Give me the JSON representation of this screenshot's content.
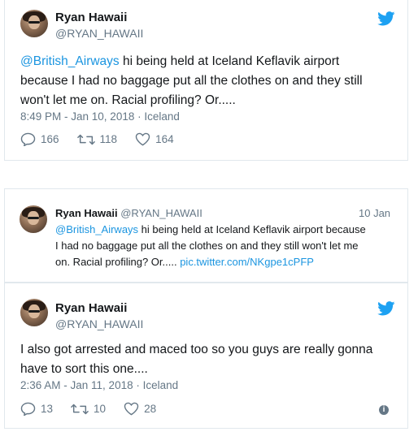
{
  "tweet1": {
    "name": "Ryan Hawaii",
    "handle": "@RYAN_HAWAII",
    "mention": "@British_Airways",
    "line1_rest": " hi being held at Iceland Keflavik airport",
    "line2": "because I had no baggage put all the clothes on and they still",
    "line3": "won't let me on. Racial profiling? Or.....",
    "timestamp": "8:49 PM - Jan 10, 2018",
    "location": "Iceland",
    "replies": "166",
    "retweets": "118",
    "likes": "164"
  },
  "quoted": {
    "name": "Ryan Hawaii",
    "handle": "@RYAN_HAWAII",
    "date": "10 Jan",
    "mention": "@British_Airways",
    "line1_rest": " hi being held at Iceland Keflavik airport because",
    "line2": "I had no baggage put all the clothes on and they still won't let me",
    "line3": "on. Racial profiling? Or.....",
    "link": "pic.twitter.com/NKgpe1cPFP"
  },
  "tweet2": {
    "name": "Ryan Hawaii",
    "handle": "@RYAN_HAWAII",
    "line1": "I also got arrested and maced too so you guys are really gonna",
    "line2": "have to sort this one....",
    "timestamp": "2:36 AM - Jan 11, 2018",
    "location": "Iceland",
    "replies": "13",
    "retweets": "10",
    "likes": "28"
  },
  "colors": {
    "twitter_blue": "#1da1f2",
    "link_blue": "#1b95e0",
    "muted": "#657786"
  }
}
